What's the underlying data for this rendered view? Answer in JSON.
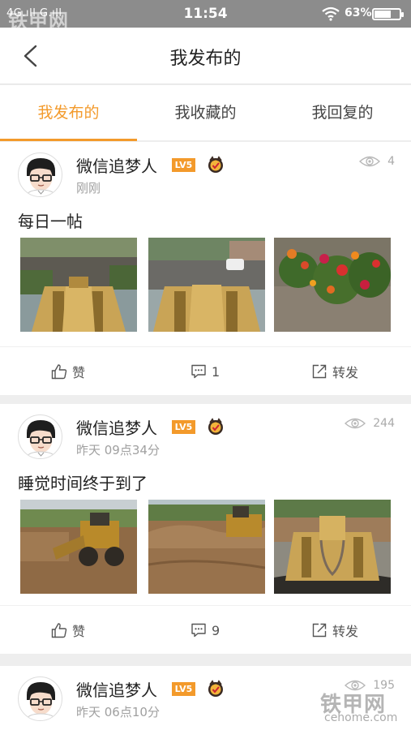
{
  "status_bar": {
    "signal_text": "4G.ıll G.ıll",
    "time": "11:54",
    "battery_text": "63%",
    "battery_level": 0.63
  },
  "watermark": {
    "brand": "铁甲网",
    "domain": "cehome.com"
  },
  "nav": {
    "title": "我发布的",
    "back_icon": "chevron-left-icon"
  },
  "tabs": [
    {
      "label": "我发布的",
      "active": true
    },
    {
      "label": "我收藏的",
      "active": false
    },
    {
      "label": "我回复的",
      "active": false
    }
  ],
  "posts": [
    {
      "author": "微信追梦人",
      "level": "LV5",
      "time": "刚刚",
      "views": "4",
      "title": "每日一帖",
      "images": [
        "loader-view",
        "loader-road",
        "red-flowers"
      ],
      "like_label": "赞",
      "comment_count": "1",
      "share_label": "转发"
    },
    {
      "author": "微信追梦人",
      "level": "LV5",
      "time": "昨天 09点34分",
      "views": "244",
      "title": "睡觉时间终于到了",
      "images": [
        "loader-dirt",
        "dirt-field",
        "loader-cab"
      ],
      "like_label": "赞",
      "comment_count": "9",
      "share_label": "转发"
    },
    {
      "author": "微信追梦人",
      "level": "LV5",
      "time": "昨天 06点10分",
      "views": "195"
    }
  ],
  "colors": {
    "accent": "#f39a2b",
    "statusbar": "#8c8c8c"
  }
}
